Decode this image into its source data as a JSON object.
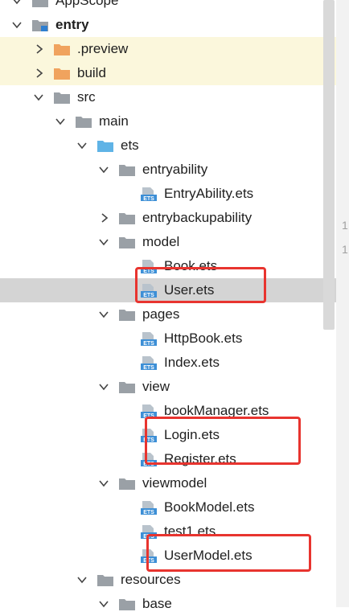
{
  "tree": [
    {
      "label": "AppScope",
      "depth": 1,
      "icon": "folder-gray-icon",
      "state": "expanded"
    },
    {
      "label": "entry",
      "depth": 1,
      "icon": "module-folder-icon",
      "state": "expanded",
      "bold": true
    },
    {
      "label": ".preview",
      "depth": 2,
      "icon": "folder-orange-icon",
      "state": "collapsed",
      "highlight": "yellow"
    },
    {
      "label": "build",
      "depth": 2,
      "icon": "folder-orange-icon",
      "state": "collapsed",
      "highlight": "yellow"
    },
    {
      "label": "src",
      "depth": 2,
      "icon": "folder-gray-icon",
      "state": "expanded"
    },
    {
      "label": "main",
      "depth": 3,
      "icon": "folder-gray-icon",
      "state": "expanded"
    },
    {
      "label": "ets",
      "depth": 4,
      "icon": "folder-blue-icon",
      "state": "expanded"
    },
    {
      "label": "entryability",
      "depth": 5,
      "icon": "folder-gray-icon",
      "state": "expanded"
    },
    {
      "label": "EntryAbility.ets",
      "depth": 6,
      "icon": "ets-file-icon",
      "state": "leaf"
    },
    {
      "label": "entrybackupability",
      "depth": 5,
      "icon": "folder-gray-icon",
      "state": "collapsed"
    },
    {
      "label": "model",
      "depth": 5,
      "icon": "folder-gray-icon",
      "state": "expanded"
    },
    {
      "label": "Book.ets",
      "depth": 6,
      "icon": "ets-file-icon",
      "state": "leaf"
    },
    {
      "label": "User.ets",
      "depth": 6,
      "icon": "ets-file-icon",
      "state": "leaf",
      "selected": true
    },
    {
      "label": "pages",
      "depth": 5,
      "icon": "folder-gray-icon",
      "state": "expanded"
    },
    {
      "label": "HttpBook.ets",
      "depth": 6,
      "icon": "ets-file-icon",
      "state": "leaf"
    },
    {
      "label": "Index.ets",
      "depth": 6,
      "icon": "ets-file-icon",
      "state": "leaf"
    },
    {
      "label": "view",
      "depth": 5,
      "icon": "folder-gray-icon",
      "state": "expanded"
    },
    {
      "label": "bookManager.ets",
      "depth": 6,
      "icon": "ets-file-icon",
      "state": "leaf"
    },
    {
      "label": "Login.ets",
      "depth": 6,
      "icon": "ets-file-icon",
      "state": "leaf"
    },
    {
      "label": "Register.ets",
      "depth": 6,
      "icon": "ets-file-icon",
      "state": "leaf"
    },
    {
      "label": "viewmodel",
      "depth": 5,
      "icon": "folder-gray-icon",
      "state": "expanded"
    },
    {
      "label": "BookModel.ets",
      "depth": 6,
      "icon": "ets-file-icon",
      "state": "leaf"
    },
    {
      "label": "test1.ets",
      "depth": 6,
      "icon": "ets-file-icon",
      "state": "leaf"
    },
    {
      "label": "UserModel.ets",
      "depth": 6,
      "icon": "ets-file-icon",
      "state": "leaf"
    },
    {
      "label": "resources",
      "depth": 4,
      "icon": "folder-gray-icon",
      "state": "expanded"
    },
    {
      "label": "base",
      "depth": 5,
      "icon": "folder-gray-icon",
      "state": "expanded"
    }
  ],
  "ets_badge": "ETS",
  "gutter_numbers": [
    "1",
    "1"
  ],
  "colors": {
    "folder_gray": "#9aa0a6",
    "folder_orange": "#f0a35e",
    "folder_blue": "#5fb3e6",
    "ets_blue": "#3d8fd6",
    "annotation_red": "#e8342f",
    "selected_row": "#d4d4d4",
    "excluded_row": "#fbf7dc"
  }
}
